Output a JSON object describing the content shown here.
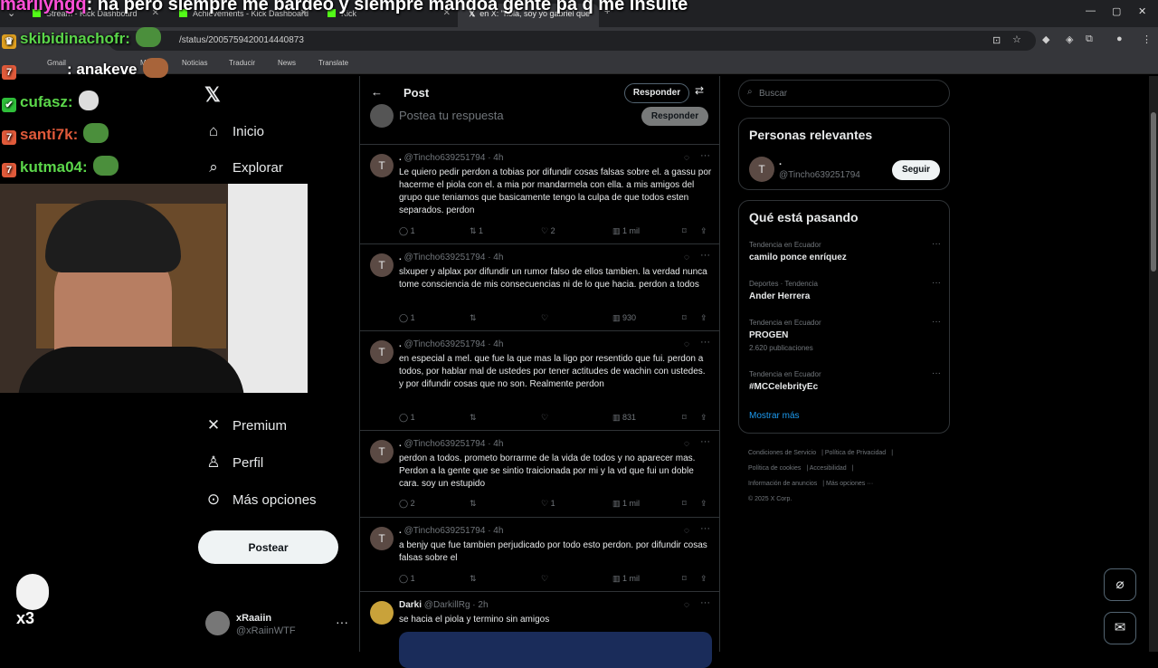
{
  "browser": {
    "tabs": [
      {
        "label": "Stream - Kick Dashboard"
      },
      {
        "label": "Achievements - Kick Dashboard"
      },
      {
        "label": "Kick"
      },
      {
        "label": "en X: \"hola, soy yo gabriel que"
      }
    ],
    "url": "/status/2005759420014440873",
    "bookmarks": [
      "Gmail",
      "Mapas",
      "Noticias",
      "Traducir",
      "News",
      "Translate"
    ]
  },
  "overlay": {
    "top_chat": {
      "user": "marilyngq",
      "message": ": na pero siempre me bardeo y siempre mandoa gente pa q me insulte"
    },
    "chat": [
      {
        "user": "skibidinachofr",
        "message": ":",
        "color": "#5bd64a"
      },
      {
        "user": "",
        "message": ": anakeve",
        "color": "#ffffff"
      },
      {
        "user": "cufasz",
        "message": ":",
        "color": "#5bd64a"
      },
      {
        "user": "santi7k",
        "message": ":",
        "color": "#e05a3a"
      },
      {
        "user": "kutma04",
        "message": ":",
        "color": "#5bd64a"
      }
    ],
    "multiplier": "x3"
  },
  "nav": {
    "items": [
      {
        "label": "Inicio",
        "icon": "home-icon",
        "glyph": "⌂"
      },
      {
        "label": "Explorar",
        "icon": "search-icon",
        "glyph": "⌕"
      },
      {
        "label": "Premium",
        "icon": "x-icon",
        "glyph": "✕"
      },
      {
        "label": "Perfil",
        "icon": "person-icon",
        "glyph": "♙"
      },
      {
        "label": "Más opciones",
        "icon": "more-circle-icon",
        "glyph": "⊙"
      }
    ],
    "post_button": "Postear",
    "account": {
      "name": "xRaaiin",
      "handle": "@xRaiinWTF"
    }
  },
  "post": {
    "title": "Post",
    "reply_button": "Responder",
    "compose_placeholder": "Postea tu respuesta",
    "compose_button": "Responder",
    "replies": [
      {
        "author": ".",
        "handle": "@Tincho639251794 · 4h",
        "avatar": "T",
        "text": "Le quiero pedir perdon a tobias por difundir cosas falsas sobre el. a gassu por hacerme el piola con el. a mia por mandarmela con ella. a mis amigos del grupo que teniamos que basicamente tengo la culpa de que todos esten separados. perdon",
        "replies": "1",
        "reposts": "1",
        "likes": "2",
        "views": "1 mil"
      },
      {
        "author": ".",
        "handle": "@Tincho639251794 · 4h",
        "avatar": "T",
        "text": "slxuper y alplax por difundir un rumor falso de ellos tambien. la verdad nunca tome consciencia de mis consecuencias ni de lo que hacia. perdon a todos",
        "replies": "1",
        "reposts": "",
        "likes": "",
        "views": "930"
      },
      {
        "author": ".",
        "handle": "@Tincho639251794 · 4h",
        "avatar": "T",
        "text": "en especial a mel. que fue la que mas la ligo por resentido que fui. perdon a todos, por hablar mal de ustedes por tener actitudes de wachin con ustedes.\ny por difundir cosas que no son. Realmente perdon",
        "replies": "1",
        "reposts": "",
        "likes": "",
        "views": "831"
      },
      {
        "author": ".",
        "handle": "@Tincho639251794 · 4h",
        "avatar": "T",
        "text": "perdon a todos. prometo borrarme de la vida de todos y no aparecer mas. Perdon a la gente que se sintio traicionada por mi y la vd que fui un doble cara. soy un estupido",
        "replies": "2",
        "reposts": "",
        "likes": "1",
        "views": "1 mil"
      },
      {
        "author": ".",
        "handle": "@Tincho639251794 · 4h",
        "avatar": "T",
        "text": "a benjy que fue tambien perjudicado por todo esto perdon. por difundir cosas falsas sobre el",
        "replies": "1",
        "reposts": "",
        "likes": "",
        "views": "1 mil"
      },
      {
        "author": "Darki",
        "handle": "@DarkillRg · 2h",
        "avatar": "",
        "text": "se hacia el piola y termino sin amigos",
        "replies": "",
        "reposts": "",
        "likes": "",
        "views": ""
      }
    ]
  },
  "sidebar": {
    "search_placeholder": "Buscar",
    "relevant": {
      "title": "Personas relevantes",
      "name": ".",
      "handle": "@Tincho639251794",
      "avatar": "T",
      "follow": "Seguir"
    },
    "trends": {
      "title": "Qué está pasando",
      "items": [
        {
          "context": "Tendencia en Ecuador",
          "name": "camilo ponce enríquez",
          "posts": ""
        },
        {
          "context": "Deportes · Tendencia",
          "name": "Ander Herrera",
          "posts": ""
        },
        {
          "context": "Tendencia en Ecuador",
          "name": "PROGEN",
          "posts": "2.620 publicaciones"
        },
        {
          "context": "Tendencia en Ecuador",
          "name": "#MCCelebrityEc",
          "posts": ""
        }
      ],
      "show_more": "Mostrar más"
    },
    "footer": [
      "Condiciones de Servicio",
      "Política de Privacidad",
      "Política de cookies",
      "Accesibilidad",
      "Información de anuncios",
      "Más opciones ···",
      "© 2025 X Corp."
    ]
  },
  "colors": {
    "accent": "#1d9bf0",
    "kick": "#53fc18"
  }
}
